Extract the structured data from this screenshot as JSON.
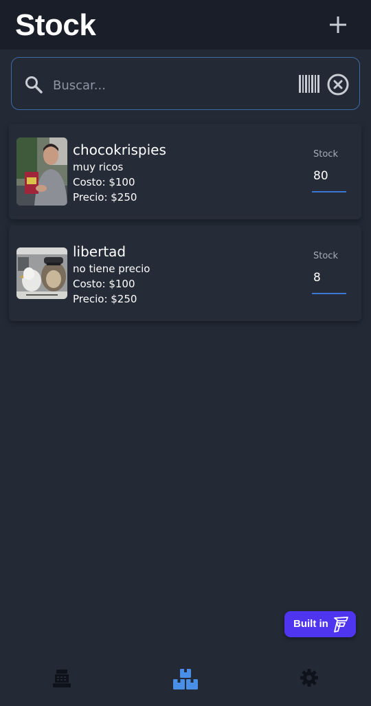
{
  "header": {
    "title": "Stock",
    "add_icon": "plus-icon"
  },
  "search": {
    "placeholder": "Buscar...",
    "value": "",
    "icons": [
      "search-icon",
      "barcode-icon",
      "clear-circle-icon"
    ]
  },
  "products": [
    {
      "name": "chocokrispies",
      "description": "muy ricos",
      "cost": "Costo: $100",
      "price": "Precio: $250",
      "stock_label": "Stock",
      "stock": "80"
    },
    {
      "name": "libertad",
      "description": "no tiene precio",
      "cost": "Costo: $100",
      "price": "Precio: $250",
      "stock_label": "Stock",
      "stock": "8"
    }
  ],
  "badge": {
    "label": "Built in"
  },
  "nav": {
    "items": [
      {
        "icon": "cash-register-icon",
        "active": false
      },
      {
        "icon": "boxes-icon",
        "active": true
      },
      {
        "icon": "gear-icon",
        "active": false
      }
    ],
    "active_color": "#4a8fe7",
    "inactive_color": "#0e121a"
  },
  "colors": {
    "background": "#232a36",
    "appbar": "#191e28",
    "accent": "#3b78d4",
    "badge": "#4f35f0"
  }
}
